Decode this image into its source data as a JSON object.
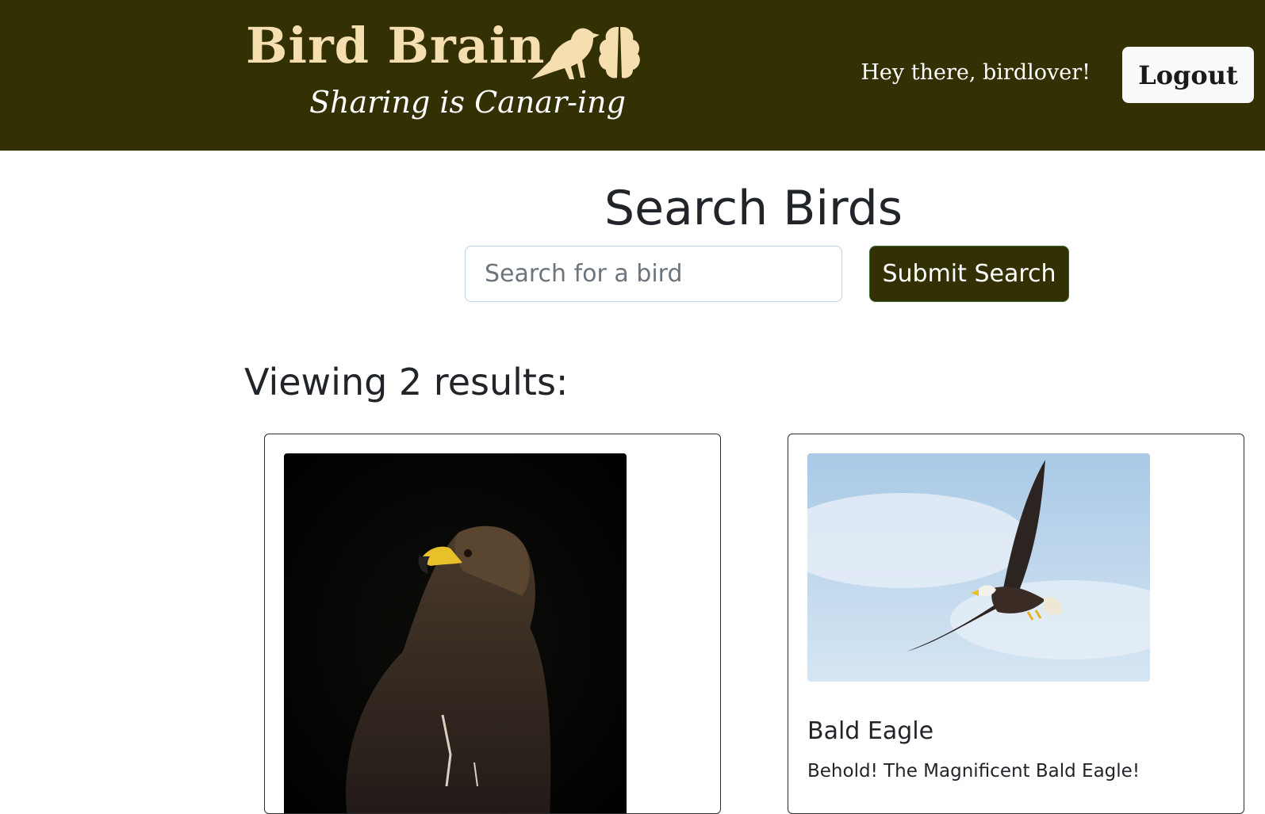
{
  "header": {
    "brand_title": "Bird Brain",
    "tagline": "Sharing is Canar-ing",
    "greeting": "Hey there, birdlover!",
    "logout_label": "Logout",
    "background_color": "#333003",
    "brand_color": "#f5dfb0"
  },
  "search": {
    "title": "Search Birds",
    "placeholder": "Search for a bird",
    "value": "",
    "submit_label": "Submit Search"
  },
  "results": {
    "count_text": "Viewing 2 results:",
    "cards": [
      {
        "image_icon": "golden-eagle-photo",
        "title": "",
        "text": ""
      },
      {
        "image_icon": "bald-eagle-photo",
        "title": "Bald Eagle",
        "text": "Behold! The Magnificent Bald Eagle!"
      }
    ]
  },
  "icons": {
    "brand_bird": "bird-icon",
    "brand_brain": "brain-icon"
  }
}
